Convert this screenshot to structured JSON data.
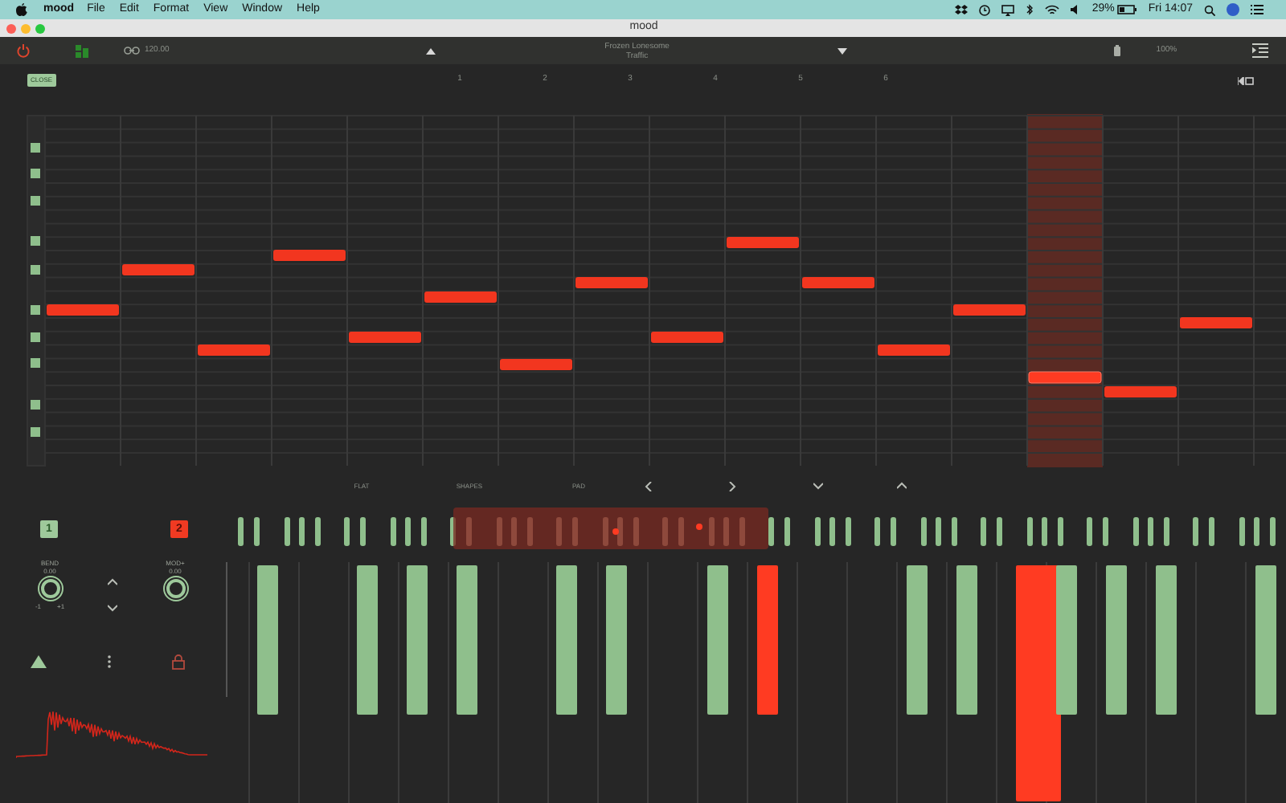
{
  "menu_bar": {
    "app": "mood",
    "items": [
      "File",
      "Edit",
      "Format",
      "View",
      "Window",
      "Help"
    ],
    "battery": "29%",
    "clock": "Fri 14:07"
  },
  "window": {
    "title": "mood"
  },
  "toolbar": {
    "tempo": "120.00",
    "song": "Frozen Lonesome",
    "track": "Traffic",
    "zoom": "100%"
  },
  "ruler": {
    "close": "CLOSE",
    "bars": [
      "1",
      "2",
      "3",
      "4",
      "5",
      "6"
    ]
  },
  "notes": [
    {
      "selected": false
    },
    {
      "selected": false
    },
    {
      "selected": false
    },
    {
      "selected": false
    },
    {
      "selected": false
    },
    {
      "selected": false
    },
    {
      "selected": false
    },
    {
      "selected": false
    },
    {
      "selected": false
    },
    {
      "selected": false
    },
    {
      "selected": false
    },
    {
      "selected": false
    },
    {
      "selected": false
    },
    {
      "selected": true
    },
    {
      "selected": false
    },
    {
      "selected": false
    }
  ],
  "controls": {
    "labels": [
      "FLAT",
      "SHAPES",
      "PAD"
    ]
  },
  "tracks": [
    {
      "label": "1",
      "selected": false
    },
    {
      "label": "2",
      "selected": true
    }
  ],
  "knobs": [
    {
      "label": "BEND",
      "reading": "0.00",
      "min": "-1",
      "max": "+1"
    },
    {
      "label": "MOD+",
      "reading": "0.00"
    }
  ],
  "keyboard": {
    "keys": [
      {
        "pressed": false
      },
      {
        "pressed": false
      },
      {
        "pressed": false
      },
      {
        "pressed": false
      },
      {
        "pressed": false
      },
      {
        "pressed": false
      },
      {
        "pressed": false
      },
      {
        "pressed": true
      },
      {
        "pressed": false
      },
      {
        "pressed": false
      },
      {
        "pressed": true
      },
      {
        "pressed": false
      },
      {
        "pressed": false
      },
      {
        "pressed": false
      },
      {
        "pressed": false
      }
    ]
  }
}
